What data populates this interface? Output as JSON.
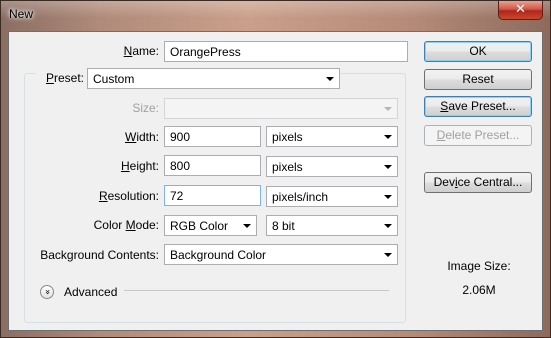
{
  "window": {
    "title": "New",
    "close_glyph": "✕"
  },
  "name": {
    "label_u": "N",
    "label_rest": "ame:",
    "value": "OrangePress"
  },
  "preset": {
    "label_u": "P",
    "label_rest": "reset:",
    "value": "Custom"
  },
  "size": {
    "label": "Size:",
    "value": ""
  },
  "width": {
    "label_u": "W",
    "label_rest": "idth:",
    "value": "900",
    "unit": "pixels"
  },
  "height": {
    "label_u": "H",
    "label_rest": "eight:",
    "value": "800",
    "unit": "pixels"
  },
  "resolution": {
    "label_u": "R",
    "label_rest": "esolution:",
    "value": "72",
    "unit": "pixels/inch"
  },
  "color_mode": {
    "label_pre": "Color ",
    "label_u": "M",
    "label_rest": "ode:",
    "value": "RGB Color",
    "bits": "8 bit"
  },
  "background": {
    "label": "Background Contents:",
    "value": "Background Color"
  },
  "advanced": {
    "label": "Advanced",
    "icon": "chevron-double-down-icon",
    "glyph": "»"
  },
  "buttons": {
    "ok": "OK",
    "reset": "Reset",
    "save_preset": {
      "u": "S",
      "rest": "ave Preset..."
    },
    "delete_preset": {
      "u": "D",
      "rest": "elete Preset..."
    },
    "device_central": {
      "pre": "Dev",
      "u": "i",
      "rest": "ce Central..."
    }
  },
  "image_size": {
    "label": "Image Size:",
    "value": "2.06M"
  },
  "colors": {
    "accent_border": "#3c7fb1",
    "focus_border": "#7eb4ea",
    "dialog_bg": "#f0f0f0"
  }
}
